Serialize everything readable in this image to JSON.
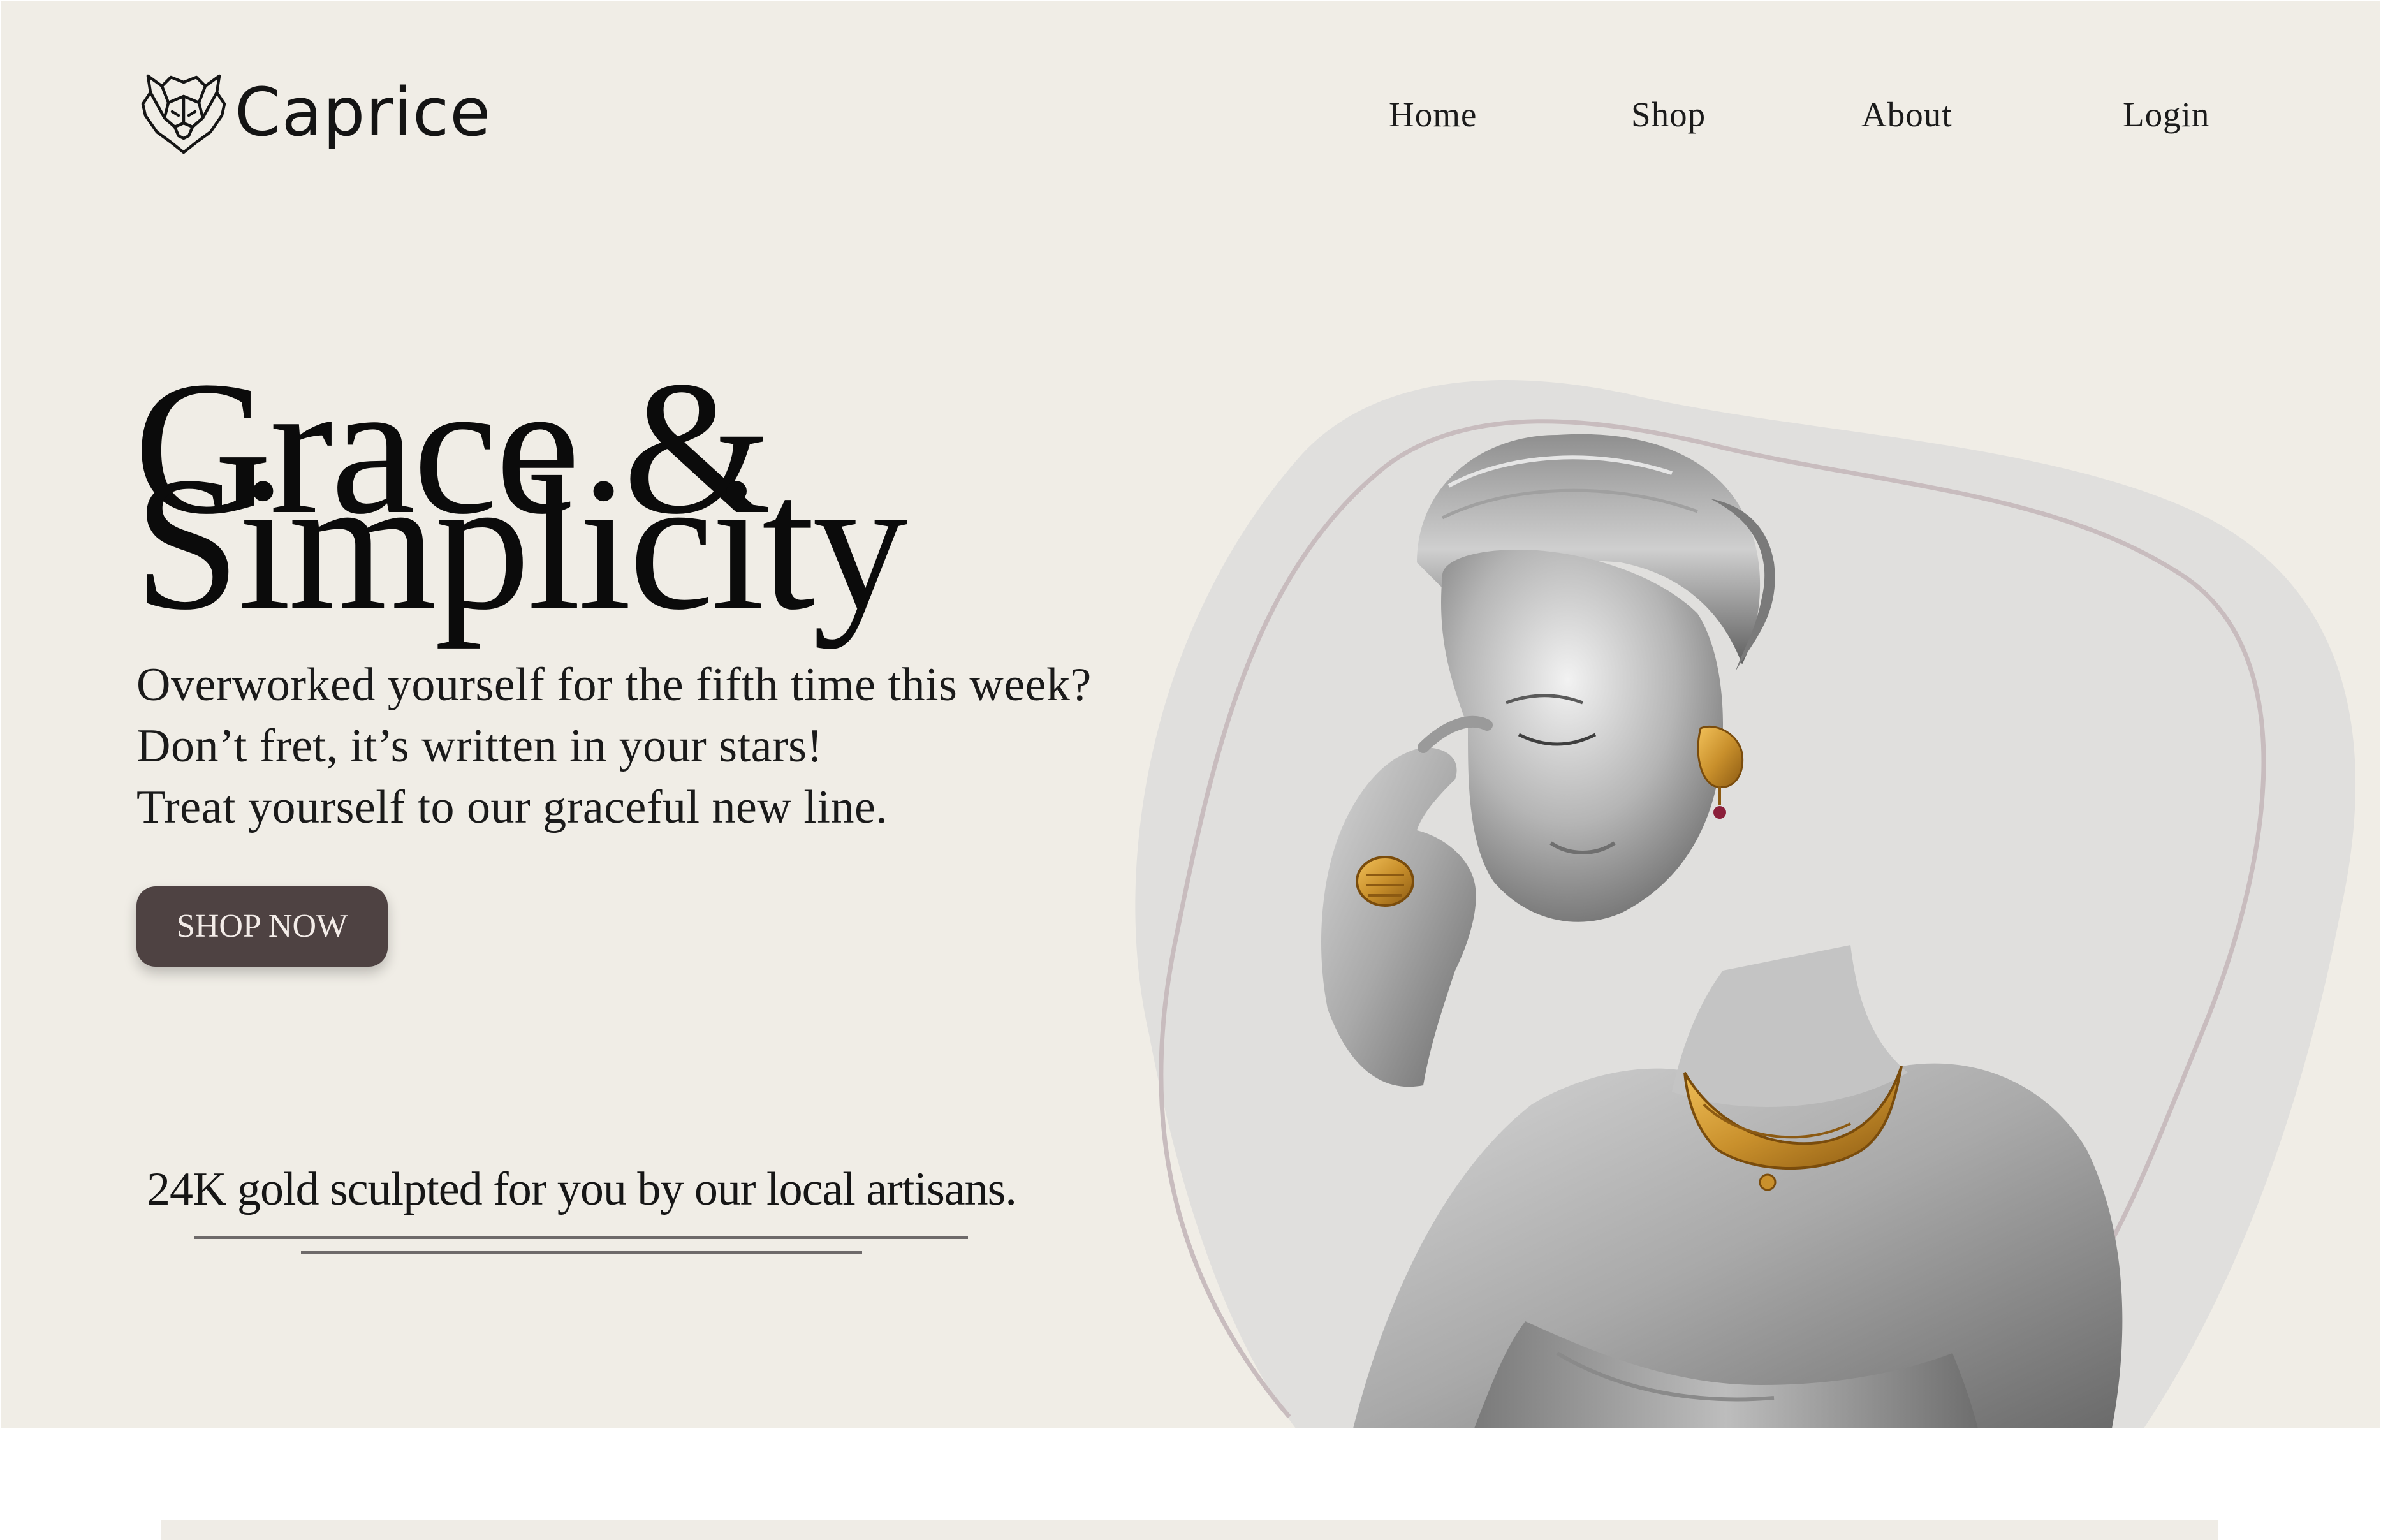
{
  "header": {
    "brand_name": "Caprice",
    "logo_icon": "lioness-head-icon",
    "nav": {
      "home": "Home",
      "shop": "Shop",
      "about": "About",
      "login": "Login"
    }
  },
  "hero": {
    "headline_line1": "Grace &",
    "headline_line2": "Simplicity",
    "tagline": [
      "Overworked yourself for the fifth time this week?",
      "Don’t fret, it’s written in your stars!",
      "Treat yourself to our graceful new line."
    ],
    "cta_label": "SHOP NOW",
    "artisans_text": "24K gold sculpted for you by our local artisans."
  },
  "illustration": {
    "subject": "woman-wearing-gold-jewelry-image"
  },
  "colors": {
    "background": "#f0ede6",
    "cta_background": "#4e4242",
    "cta_text": "#f3ece8",
    "blob": "#e0dfdd",
    "outline": "#c8bcbe",
    "gold": "#c9902c"
  }
}
